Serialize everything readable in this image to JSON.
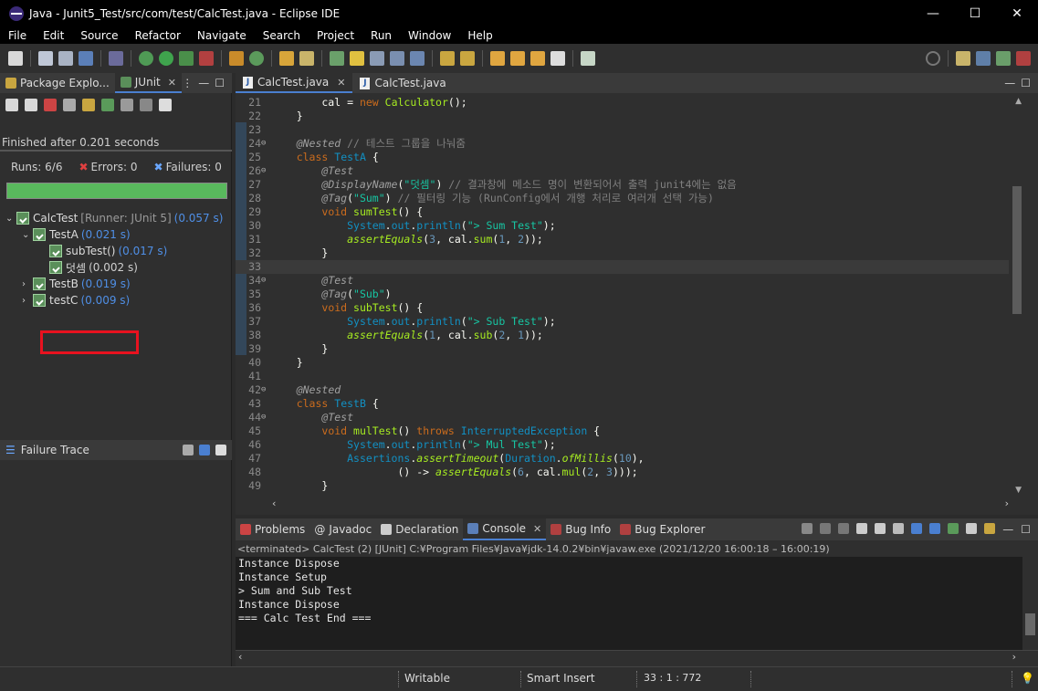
{
  "window": {
    "title": "Java - Junit5_Test/src/com/test/CalcTest.java - Eclipse IDE",
    "minimize": "—",
    "maximize": "☐",
    "close": "✕"
  },
  "menu": [
    "File",
    "Edit",
    "Source",
    "Refactor",
    "Navigate",
    "Search",
    "Project",
    "Run",
    "Window",
    "Help"
  ],
  "left_tabs": {
    "package_explorer": "Package Explo...",
    "junit": "JUnit"
  },
  "junit": {
    "finished": "Finished after 0.201 seconds",
    "runs_label": "Runs:",
    "runs_value": "6/6",
    "errors_label": "Errors:",
    "errors_value": "0",
    "failures_label": "Failures:",
    "failures_value": "0",
    "progress_fraction": 1.0,
    "progress_color": "#59b95d",
    "tree": [
      {
        "name": "CalcTest",
        "extra": "[Runner: JUnit 5]",
        "time": "(0.057 s)"
      },
      {
        "name": "TestA",
        "time": "(0.021 s)"
      },
      {
        "name": "subTest()",
        "time": "(0.017 s)"
      },
      {
        "name": "덧셈",
        "time": "(0.002 s)"
      },
      {
        "name": "TestB",
        "time": "(0.019 s)"
      },
      {
        "name": "testC",
        "time": "(0.009 s)"
      }
    ],
    "highlight_color": "#e8121f"
  },
  "failure_trace": {
    "label": "Failure Trace"
  },
  "editor": {
    "tabs": [
      {
        "label": "CalcTest.java"
      },
      {
        "label": "CalcTest.java"
      }
    ],
    "lines": [
      {
        "n": "21",
        "segs": [
          [
            "pl",
            "        cal = "
          ],
          [
            "k",
            "new"
          ],
          [
            "pl",
            " "
          ],
          [
            "fn",
            "Calculator"
          ],
          [
            "pl",
            "();"
          ]
        ]
      },
      {
        "n": "22",
        "segs": [
          [
            "pl",
            "    }"
          ]
        ]
      },
      {
        "n": "23",
        "segs": []
      },
      {
        "n": "24",
        "fold": true,
        "segs": [
          [
            "pl",
            "    "
          ],
          [
            "an",
            "@Nested"
          ],
          [
            "pl",
            " "
          ],
          [
            "cm",
            "// 테스트 그룹을 나눠줌"
          ]
        ]
      },
      {
        "n": "25",
        "segs": [
          [
            "pl",
            "    "
          ],
          [
            "k",
            "class"
          ],
          [
            "pl",
            " "
          ],
          [
            "cl",
            "TestA"
          ],
          [
            "pl",
            " {"
          ]
        ]
      },
      {
        "n": "26",
        "fold": true,
        "segs": [
          [
            "pl",
            "        "
          ],
          [
            "an",
            "@Test"
          ]
        ]
      },
      {
        "n": "27",
        "segs": [
          [
            "pl",
            "        "
          ],
          [
            "an",
            "@DisplayName"
          ],
          [
            "pl",
            "("
          ],
          [
            "st",
            "\"덧셈\""
          ],
          [
            "pl",
            ") "
          ],
          [
            "cm",
            "// 결과창에 메소드 명이 변환되어서 출력 junit4에는 없음"
          ]
        ]
      },
      {
        "n": "28",
        "segs": [
          [
            "pl",
            "        "
          ],
          [
            "an",
            "@Tag"
          ],
          [
            "pl",
            "("
          ],
          [
            "st",
            "\"Sum\""
          ],
          [
            "pl",
            ") "
          ],
          [
            "cm",
            "// 필터링 기능 (RunConfig에서 개행 처리로 여러개 선택 가능)"
          ]
        ]
      },
      {
        "n": "29",
        "segs": [
          [
            "pl",
            "        "
          ],
          [
            "k",
            "void"
          ],
          [
            "pl",
            " "
          ],
          [
            "fn",
            "sumTest"
          ],
          [
            "pl",
            "() {"
          ]
        ]
      },
      {
        "n": "30",
        "segs": [
          [
            "pl",
            "            "
          ],
          [
            "ty",
            "System"
          ],
          [
            "pl",
            "."
          ],
          [
            "ty",
            "out"
          ],
          [
            "pl",
            "."
          ],
          [
            "ty",
            "println"
          ],
          [
            "pl",
            "("
          ],
          [
            "st",
            "\"> Sum Test\""
          ],
          [
            "pl",
            ");"
          ]
        ]
      },
      {
        "n": "31",
        "segs": [
          [
            "pl",
            "            "
          ],
          [
            "fi",
            "assertEquals"
          ],
          [
            "pl",
            "("
          ],
          [
            "nu",
            "3"
          ],
          [
            "pl",
            ", cal."
          ],
          [
            "fn",
            "sum"
          ],
          [
            "pl",
            "("
          ],
          [
            "nu",
            "1"
          ],
          [
            "pl",
            ", "
          ],
          [
            "nu",
            "2"
          ],
          [
            "pl",
            "));"
          ]
        ]
      },
      {
        "n": "32",
        "segs": [
          [
            "pl",
            "        }"
          ]
        ]
      },
      {
        "n": "33",
        "cur": true,
        "segs": []
      },
      {
        "n": "34",
        "fold": true,
        "segs": [
          [
            "pl",
            "        "
          ],
          [
            "an",
            "@Test"
          ]
        ]
      },
      {
        "n": "35",
        "segs": [
          [
            "pl",
            "        "
          ],
          [
            "an",
            "@Tag"
          ],
          [
            "pl",
            "("
          ],
          [
            "st",
            "\"Sub\""
          ],
          [
            "pl",
            ")"
          ]
        ]
      },
      {
        "n": "36",
        "segs": [
          [
            "pl",
            "        "
          ],
          [
            "k",
            "void"
          ],
          [
            "pl",
            " "
          ],
          [
            "fn",
            "subTest"
          ],
          [
            "pl",
            "() {"
          ]
        ]
      },
      {
        "n": "37",
        "segs": [
          [
            "pl",
            "            "
          ],
          [
            "ty",
            "System"
          ],
          [
            "pl",
            "."
          ],
          [
            "ty",
            "out"
          ],
          [
            "pl",
            "."
          ],
          [
            "ty",
            "println"
          ],
          [
            "pl",
            "("
          ],
          [
            "st",
            "\"> Sub Test\""
          ],
          [
            "pl",
            ");"
          ]
        ]
      },
      {
        "n": "38",
        "segs": [
          [
            "pl",
            "            "
          ],
          [
            "fi",
            "assertEquals"
          ],
          [
            "pl",
            "("
          ],
          [
            "nu",
            "1"
          ],
          [
            "pl",
            ", cal."
          ],
          [
            "fn",
            "sub"
          ],
          [
            "pl",
            "("
          ],
          [
            "nu",
            "2"
          ],
          [
            "pl",
            ", "
          ],
          [
            "nu",
            "1"
          ],
          [
            "pl",
            "));"
          ]
        ]
      },
      {
        "n": "39",
        "segs": [
          [
            "pl",
            "        }"
          ]
        ]
      },
      {
        "n": "40",
        "segs": [
          [
            "pl",
            "    }"
          ]
        ]
      },
      {
        "n": "41",
        "segs": []
      },
      {
        "n": "42",
        "fold": true,
        "segs": [
          [
            "pl",
            "    "
          ],
          [
            "an",
            "@Nested"
          ]
        ]
      },
      {
        "n": "43",
        "segs": [
          [
            "pl",
            "    "
          ],
          [
            "k",
            "class"
          ],
          [
            "pl",
            " "
          ],
          [
            "cl",
            "TestB"
          ],
          [
            "pl",
            " {"
          ]
        ]
      },
      {
        "n": "44",
        "fold": true,
        "segs": [
          [
            "pl",
            "        "
          ],
          [
            "an",
            "@Test"
          ]
        ]
      },
      {
        "n": "45",
        "segs": [
          [
            "pl",
            "        "
          ],
          [
            "k",
            "void"
          ],
          [
            "pl",
            " "
          ],
          [
            "fn",
            "mulTest"
          ],
          [
            "pl",
            "() "
          ],
          [
            "k",
            "throws"
          ],
          [
            "pl",
            " "
          ],
          [
            "ty",
            "InterruptedException"
          ],
          [
            "pl",
            " {"
          ]
        ]
      },
      {
        "n": "46",
        "segs": [
          [
            "pl",
            "            "
          ],
          [
            "ty",
            "System"
          ],
          [
            "pl",
            "."
          ],
          [
            "ty",
            "out"
          ],
          [
            "pl",
            "."
          ],
          [
            "ty",
            "println"
          ],
          [
            "pl",
            "("
          ],
          [
            "st",
            "\"> Mul Test\""
          ],
          [
            "pl",
            ");"
          ]
        ]
      },
      {
        "n": "47",
        "segs": [
          [
            "pl",
            "            "
          ],
          [
            "ty",
            "Assertions"
          ],
          [
            "pl",
            "."
          ],
          [
            "fi",
            "assertTimeout"
          ],
          [
            "pl",
            "("
          ],
          [
            "ty",
            "Duration"
          ],
          [
            "pl",
            "."
          ],
          [
            "fi",
            "ofMillis"
          ],
          [
            "pl",
            "("
          ],
          [
            "nu",
            "10"
          ],
          [
            "pl",
            "),"
          ]
        ]
      },
      {
        "n": "48",
        "segs": [
          [
            "pl",
            "                    () -> "
          ],
          [
            "fi",
            "assertEquals"
          ],
          [
            "pl",
            "("
          ],
          [
            "nu",
            "6"
          ],
          [
            "pl",
            ", cal."
          ],
          [
            "fn",
            "mul"
          ],
          [
            "pl",
            "("
          ],
          [
            "nu",
            "2"
          ],
          [
            "pl",
            ", "
          ],
          [
            "nu",
            "3"
          ],
          [
            "pl",
            ")));"
          ]
        ]
      },
      {
        "n": "49",
        "segs": [
          [
            "pl",
            "        }"
          ]
        ]
      }
    ]
  },
  "console": {
    "tabs": [
      {
        "label": "Problems"
      },
      {
        "label": "Javadoc"
      },
      {
        "label": "Declaration"
      },
      {
        "label": "Console"
      },
      {
        "label": "Bug Info"
      },
      {
        "label": "Bug Explorer"
      }
    ],
    "terminated": "<terminated> CalcTest (2) [JUnit] C:¥Program Files¥Java¥jdk-14.0.2¥bin¥javaw.exe  (2021/12/20 16:00:18 – 16:00:19)",
    "output": [
      "Instance Dispose",
      "Instance Setup",
      "> Sum and Sub Test",
      "Instance Dispose",
      "=== Calc Test End ==="
    ]
  },
  "statusbar": {
    "writable": "Writable",
    "insert_mode": "Smart Insert",
    "position": "33 : 1 : 772"
  }
}
